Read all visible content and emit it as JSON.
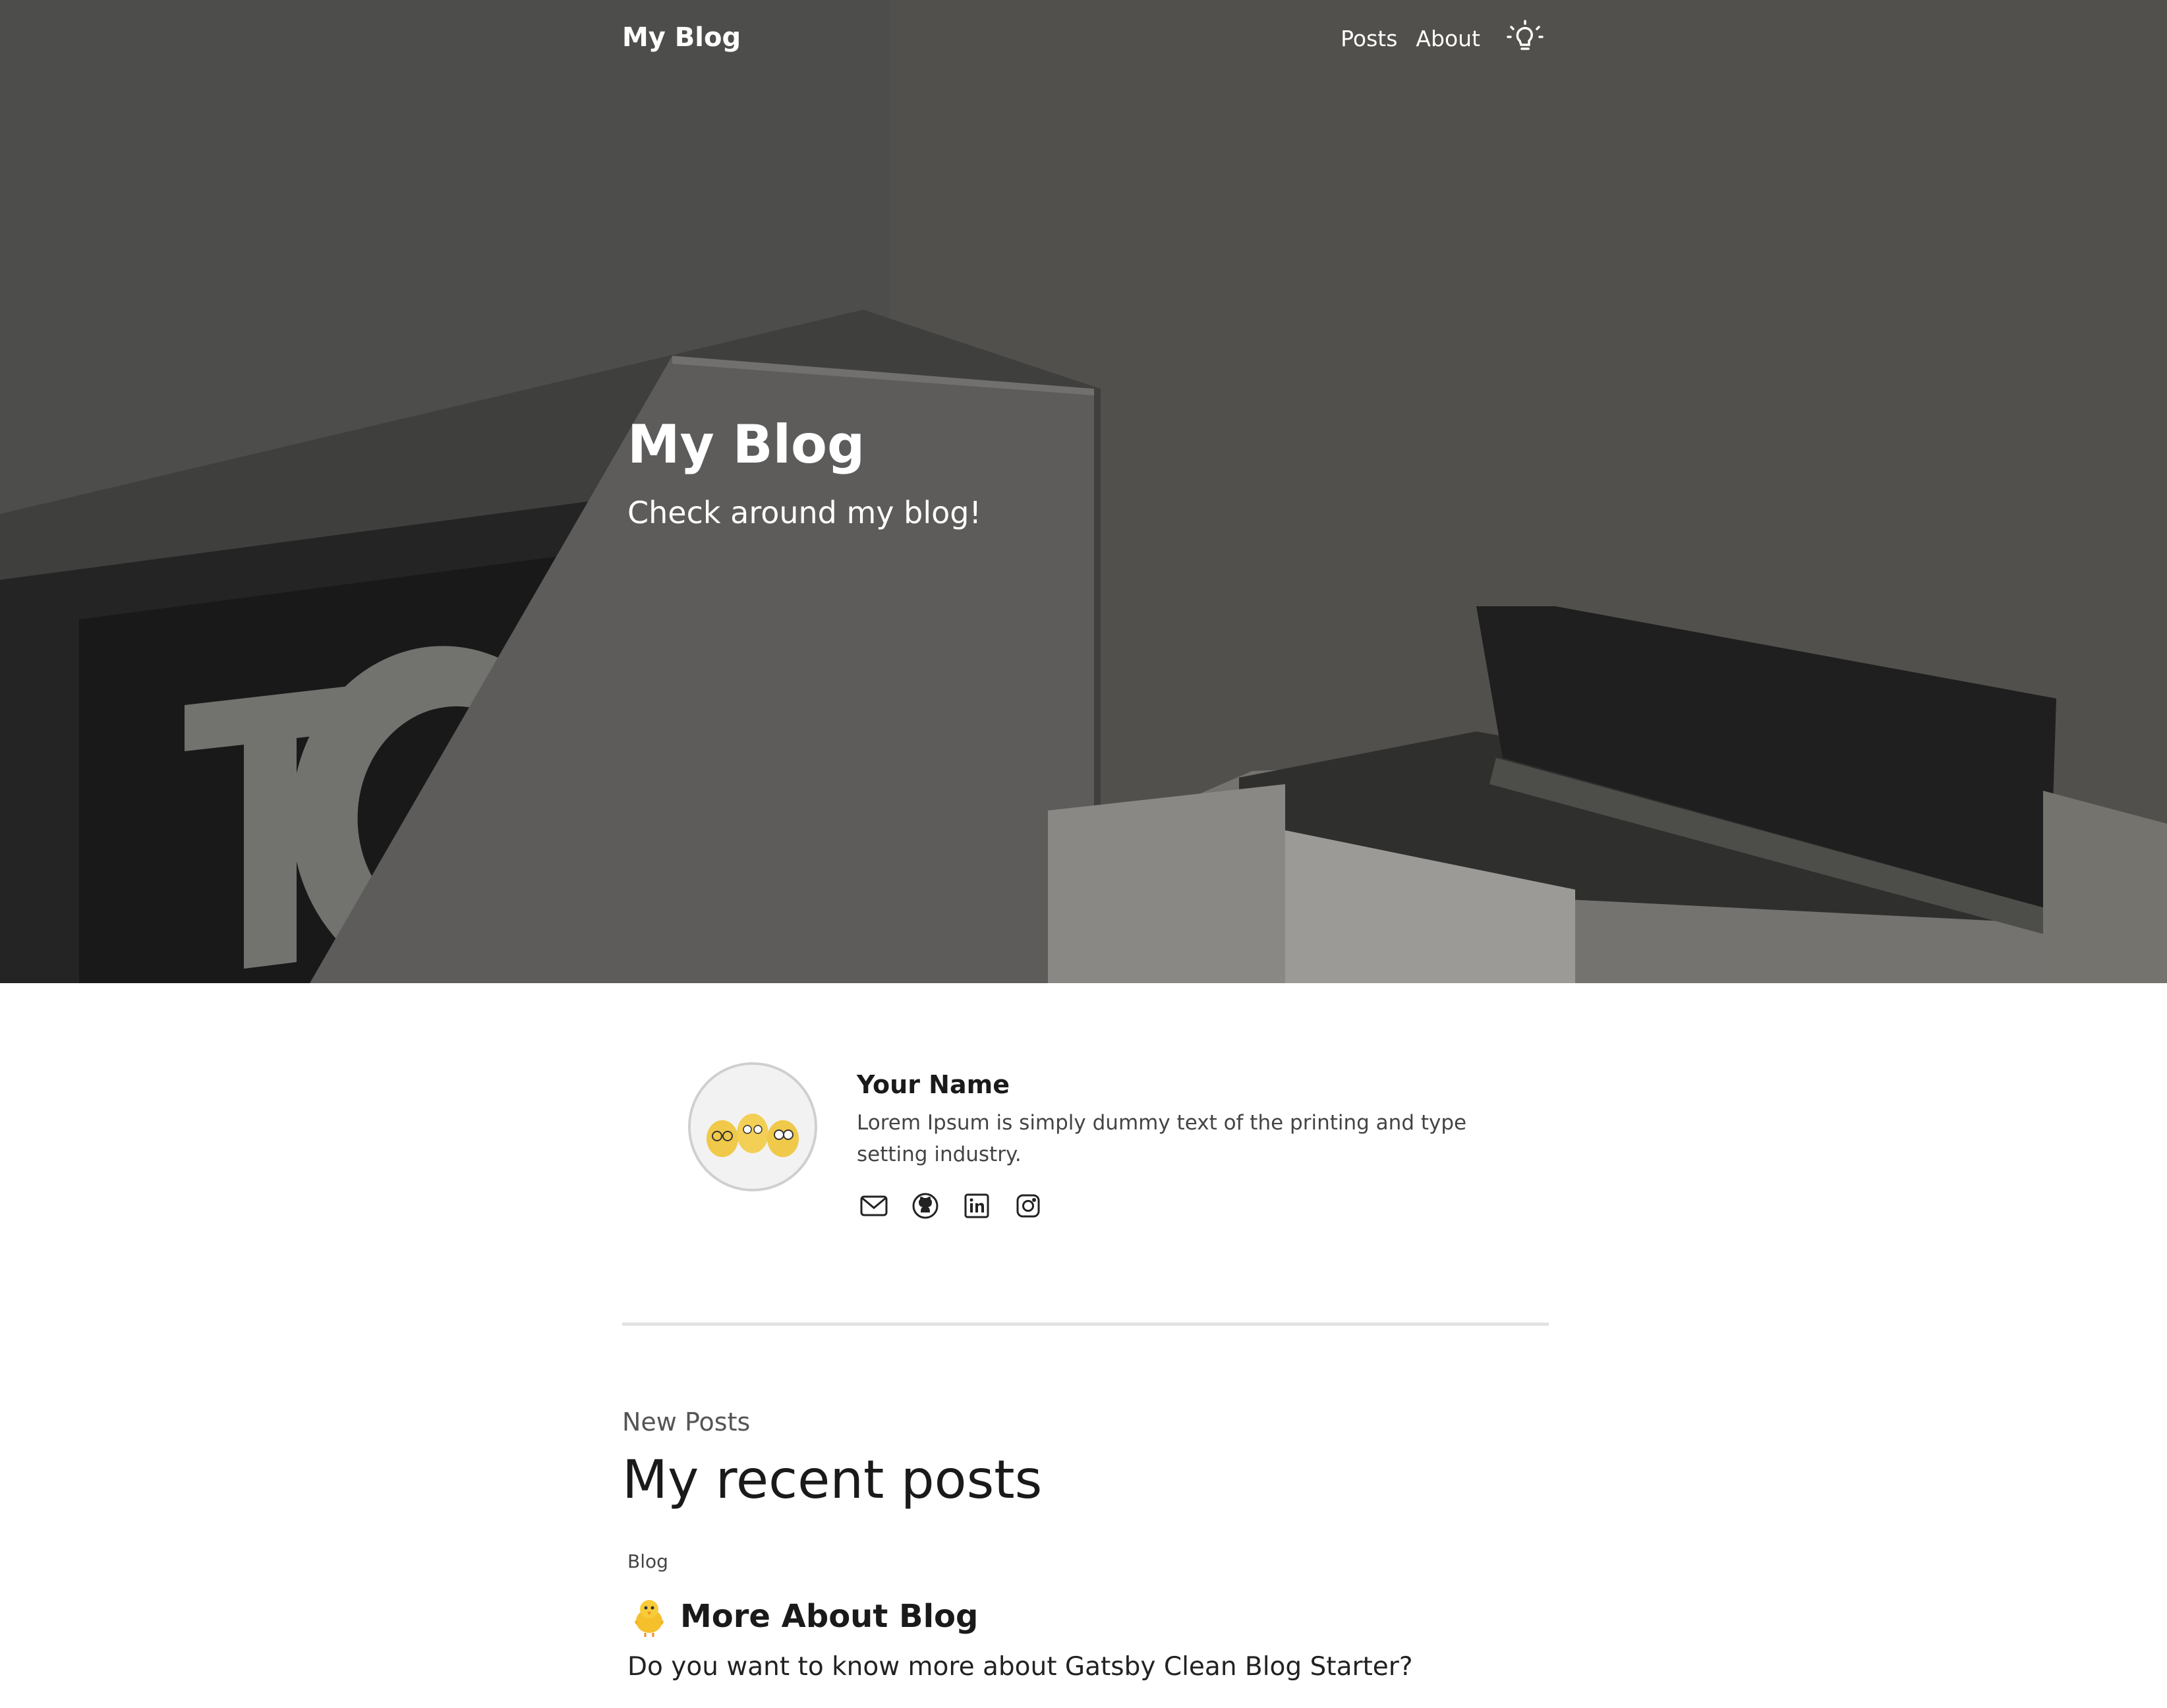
{
  "nav": {
    "brand": "My Blog",
    "links": [
      "Posts",
      "About"
    ],
    "theme_toggle_icon": "lightbulb-icon"
  },
  "hero": {
    "title": "My Blog",
    "subtitle": "Check around my blog!",
    "background": "grayscale photo of books on a shelf"
  },
  "profile": {
    "name": "Your Name",
    "bio": "Lorem Ipsum is simply dummy text of the printing and type setting industry.",
    "avatar": "three yellow egg characters with glasses",
    "social_icons": [
      "mail-icon",
      "github-icon",
      "linkedin-icon",
      "instagram-icon"
    ]
  },
  "posts": {
    "eyebrow": "New Posts",
    "heading": "My recent posts",
    "items": [
      {
        "category": "Blog",
        "emoji": "🐥",
        "title": "More About Blog",
        "description": "Do you want to know more about Gatsby Clean Blog Starter?"
      }
    ]
  },
  "colors": {
    "hero_overlay": "#5c5b59",
    "text_dark": "#1a1a1a",
    "divider": "#e2e2e2"
  }
}
